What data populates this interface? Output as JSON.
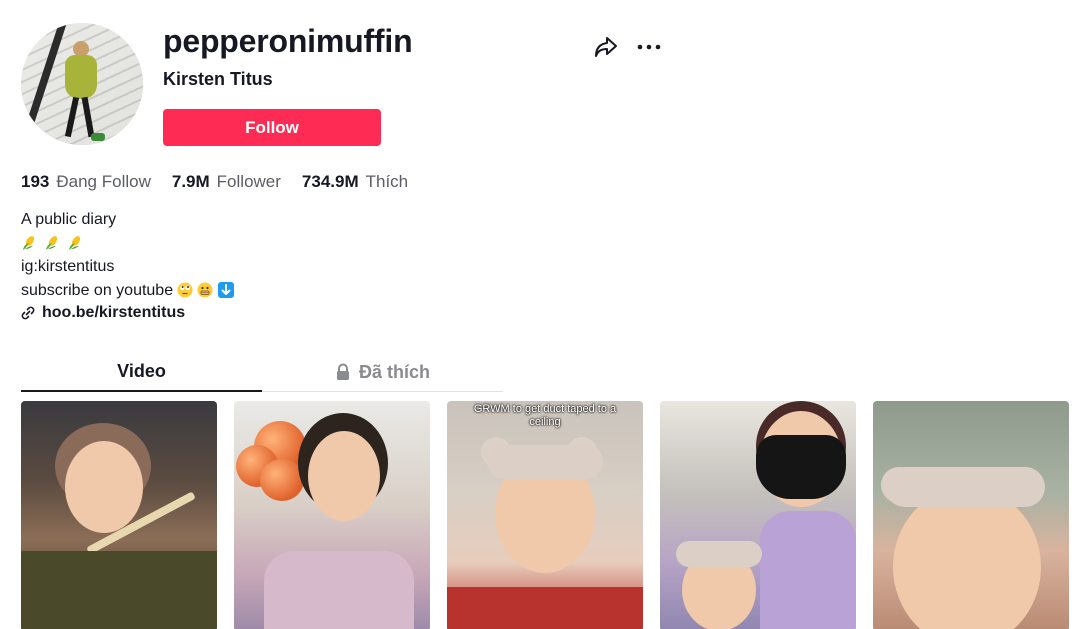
{
  "profile": {
    "username": "pepperonimuffin",
    "nickname": "Kirsten Titus",
    "follow_label": "Follow"
  },
  "stats": [
    {
      "value": "193",
      "label": "Đang Follow"
    },
    {
      "value": "7.9M",
      "label": "Follower"
    },
    {
      "value": "734.9M",
      "label": "Thích"
    }
  ],
  "bio": {
    "line1": "A public diary",
    "line2_icons": [
      "corn-emoji",
      "corn-emoji",
      "corn-emoji"
    ],
    "line3": "ig:kirstentitus",
    "line4": "subscribe on youtube",
    "line4_icons": [
      "face-with-rolling-eyes-emoji",
      "grimacing-face-emoji",
      "down-arrow-emoji"
    ]
  },
  "link": {
    "text": "hoo.be/kirstentitus"
  },
  "tabs": [
    {
      "label": "Video",
      "active": true
    },
    {
      "label": "Đã thích",
      "active": false,
      "locked": true
    }
  ],
  "videos": [
    {
      "id": "video-1",
      "caption": ""
    },
    {
      "id": "video-2",
      "caption": ""
    },
    {
      "id": "video-3",
      "caption": "GRWM to get duct taped to a ceiling"
    },
    {
      "id": "video-4",
      "caption": ""
    },
    {
      "id": "video-5",
      "caption": ""
    }
  ],
  "colors": {
    "accent": "#fe2c55",
    "text_primary": "#161823",
    "text_secondary": "#5c5d64"
  }
}
